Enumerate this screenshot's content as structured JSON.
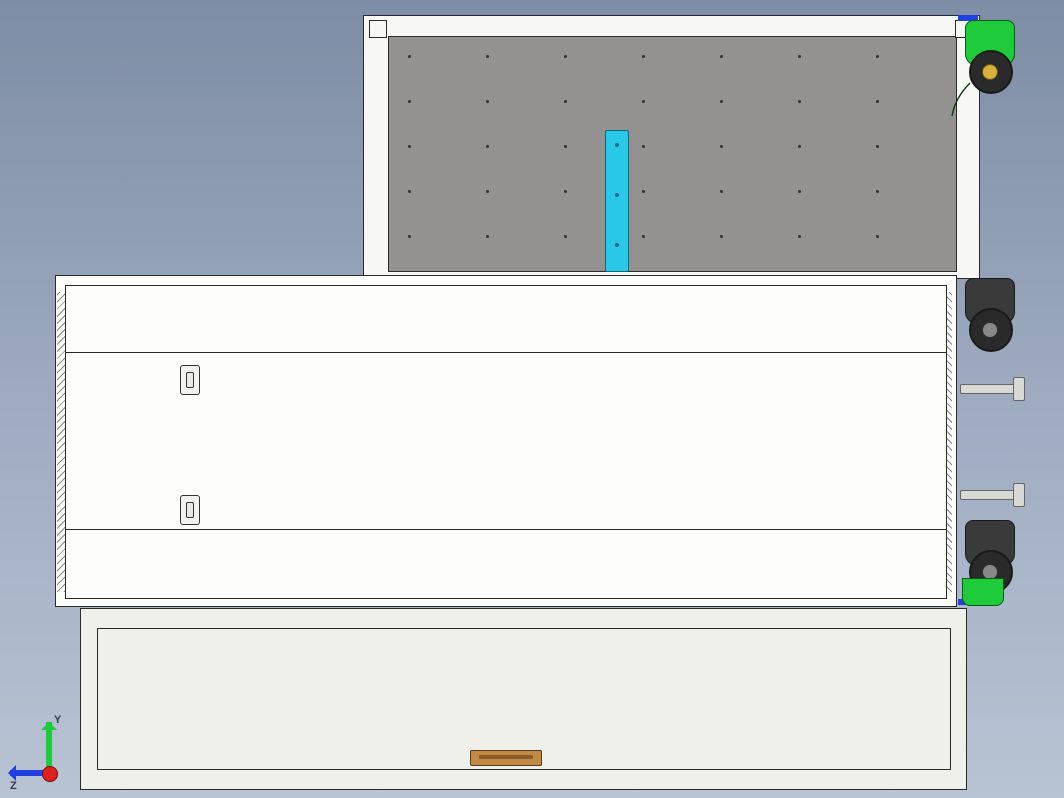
{
  "axes": {
    "y_label": "Y",
    "z_label": "Z"
  },
  "colors": {
    "caster_green": "#1ecb3a",
    "cyan_bar": "#28c8e8",
    "axis_y": "#1ecb3a",
    "axis_z": "#2040e0",
    "origin": "#e02020",
    "handle": "#c08a45"
  },
  "model": {
    "view": "orthographic",
    "assemblies": [
      "upper-perforated-panel",
      "middle-cabinet",
      "lower-drawer",
      "casters",
      "leveling-feet"
    ]
  }
}
